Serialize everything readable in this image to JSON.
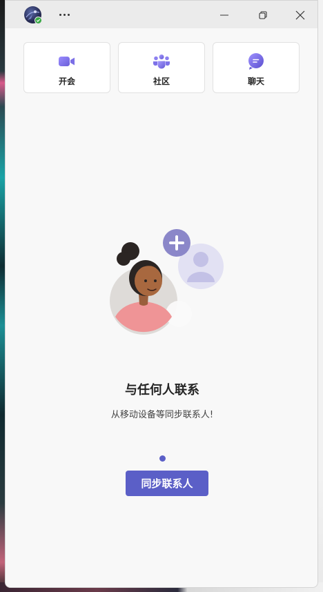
{
  "titlebar": {
    "avatar_icon": "user-avatar",
    "presence": "available",
    "presence_color": "#39a845",
    "more_icon": "more-horizontal-icon",
    "controls": [
      "minimize-icon",
      "restore-icon",
      "close-icon"
    ]
  },
  "quick_actions": [
    {
      "label": "开会",
      "icon": "video-camera-icon"
    },
    {
      "label": "社区",
      "icon": "people-community-icon"
    },
    {
      "label": "聊天",
      "icon": "chat-bubble-icon"
    }
  ],
  "main": {
    "headline": "与任何人联系",
    "subline": "从移动设备等同步联系人!",
    "pager": {
      "current": 1,
      "total": 1
    },
    "sync_button_label": "同步联系人"
  },
  "colors": {
    "accent": "#5b5fc7",
    "window_bg": "#f8f8f8",
    "titlebar_bg": "#ebebeb"
  }
}
